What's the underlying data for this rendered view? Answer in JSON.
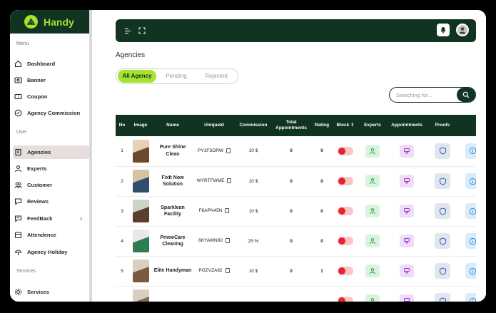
{
  "brand": {
    "name": "Handy"
  },
  "sidebar": {
    "menu_label": "Menu",
    "menu_items": [
      {
        "label": "Dashboard",
        "icon": "home-icon"
      },
      {
        "label": "Banner",
        "icon": "image-icon"
      },
      {
        "label": "Coupon",
        "icon": "ticket-icon"
      },
      {
        "label": "Agency Commission",
        "icon": "commission-icon"
      }
    ],
    "user_label": "User",
    "user_items": [
      {
        "label": "Agencies",
        "icon": "building-icon",
        "active": true
      },
      {
        "label": "Experts",
        "icon": "expert-icon"
      },
      {
        "label": "Customer",
        "icon": "users-icon"
      },
      {
        "label": "Reviews",
        "icon": "chat-icon"
      },
      {
        "label": "FeedBack",
        "icon": "feedback-icon",
        "has_arrow": true
      },
      {
        "label": "Attendence",
        "icon": "calendar-icon"
      },
      {
        "label": "Agency Holiday",
        "icon": "holiday-icon"
      }
    ],
    "services_label": "Services",
    "services_items": [
      {
        "label": "Services",
        "icon": "gear-icon"
      }
    ]
  },
  "page": {
    "title": "Agencies"
  },
  "tabs": [
    {
      "label": "All Agency",
      "active": true
    },
    {
      "label": "Pending"
    },
    {
      "label": "Rejected"
    }
  ],
  "search": {
    "placeholder": "Searching for..."
  },
  "table": {
    "headers": [
      "No",
      "Image",
      "Name",
      "UniqueId",
      "Commission",
      "Total Appointments",
      "Rating",
      "Block",
      "Experts",
      "Appointments",
      "Proofs",
      ""
    ],
    "rows": [
      {
        "no": "1",
        "name": "Pure Shine Clean",
        "uid": "PY1FSDRW",
        "commission": "10 $",
        "appointments": "0",
        "rating": "0"
      },
      {
        "no": "2",
        "name": "FixIt Now Solution",
        "uid": "WYRTFWME",
        "commission": "10 $",
        "appointments": "0",
        "rating": "0"
      },
      {
        "no": "3",
        "name": "Sparklean Facility",
        "uid": "F6APN45N",
        "commission": "10 $",
        "appointments": "0",
        "rating": "0"
      },
      {
        "no": "4",
        "name": "PrimeCare Cleaning",
        "uid": "6KYAWN92",
        "commission": "25 %",
        "appointments": "0",
        "rating": "0"
      },
      {
        "no": "5",
        "name": "Elite Handyman",
        "uid": "PGZVZA82",
        "commission": "10 $",
        "appointments": "0",
        "rating": "1"
      },
      {
        "no": "",
        "name": "",
        "uid": "",
        "commission": "",
        "appointments": "",
        "rating": ""
      }
    ]
  },
  "colors": {
    "primary": "#103322",
    "accent": "#a6e22e",
    "danger": "#e8242a"
  }
}
